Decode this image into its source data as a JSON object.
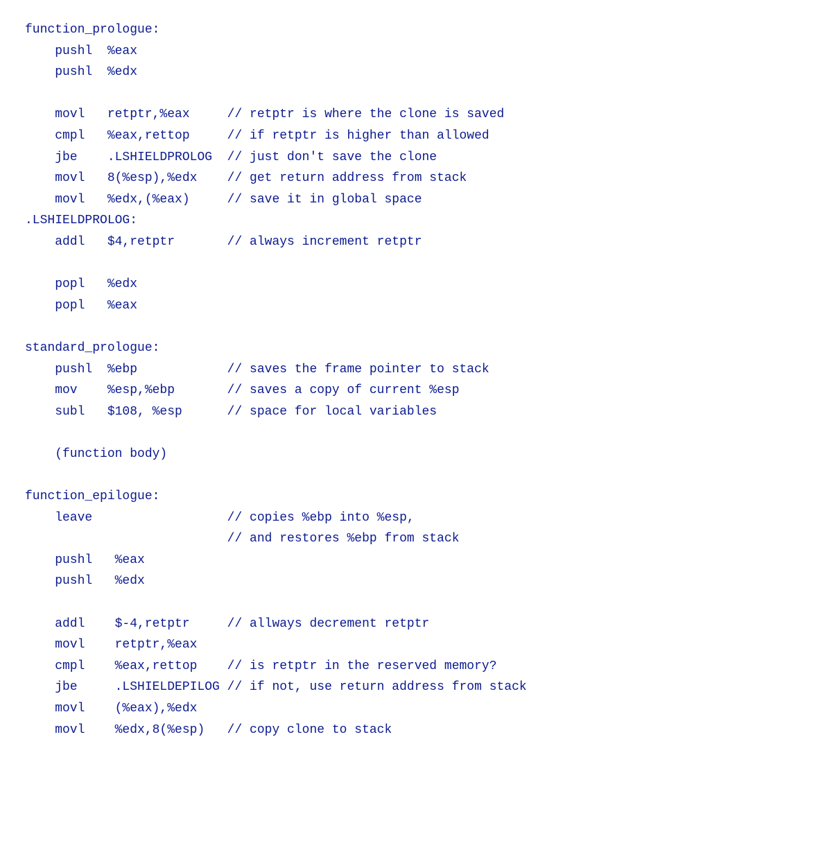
{
  "lines": [
    {
      "text": "function_prologue:"
    },
    {
      "text": "    pushl  %eax"
    },
    {
      "text": "    pushl  %edx"
    },
    {
      "text": ""
    },
    {
      "text": "    movl   retptr,%eax     // retptr is where the clone is saved"
    },
    {
      "text": "    cmpl   %eax,rettop     // if retptr is higher than allowed"
    },
    {
      "text": "    jbe    .LSHIELDPROLOG  // just don't save the clone"
    },
    {
      "text": "    movl   8(%esp),%edx    // get return address from stack"
    },
    {
      "text": "    movl   %edx,(%eax)     // save it in global space"
    },
    {
      "text": ".LSHIELDPROLOG:"
    },
    {
      "text": "    addl   $4,retptr       // always increment retptr"
    },
    {
      "text": ""
    },
    {
      "text": "    popl   %edx"
    },
    {
      "text": "    popl   %eax"
    },
    {
      "text": ""
    },
    {
      "text": "standard_prologue:"
    },
    {
      "text": "    pushl  %ebp            // saves the frame pointer to stack"
    },
    {
      "text": "    mov    %esp,%ebp       // saves a copy of current %esp"
    },
    {
      "text": "    subl   $108, %esp      // space for local variables"
    },
    {
      "text": ""
    },
    {
      "text": "    (function body)"
    },
    {
      "text": ""
    },
    {
      "text": "function_epilogue:"
    },
    {
      "text": "    leave                  // copies %ebp into %esp,"
    },
    {
      "text": "                           // and restores %ebp from stack"
    },
    {
      "text": "    pushl   %eax"
    },
    {
      "text": "    pushl   %edx"
    },
    {
      "text": ""
    },
    {
      "text": "    addl    $-4,retptr     // allways decrement retptr"
    },
    {
      "text": "    movl    retptr,%eax"
    },
    {
      "text": "    cmpl    %eax,rettop    // is retptr in the reserved memory?"
    },
    {
      "text": "    jbe     .LSHIELDEPILOG // if not, use return address from stack"
    },
    {
      "text": "    movl    (%eax),%edx"
    },
    {
      "text": "    movl    %edx,8(%esp)   // copy clone to stack"
    }
  ]
}
